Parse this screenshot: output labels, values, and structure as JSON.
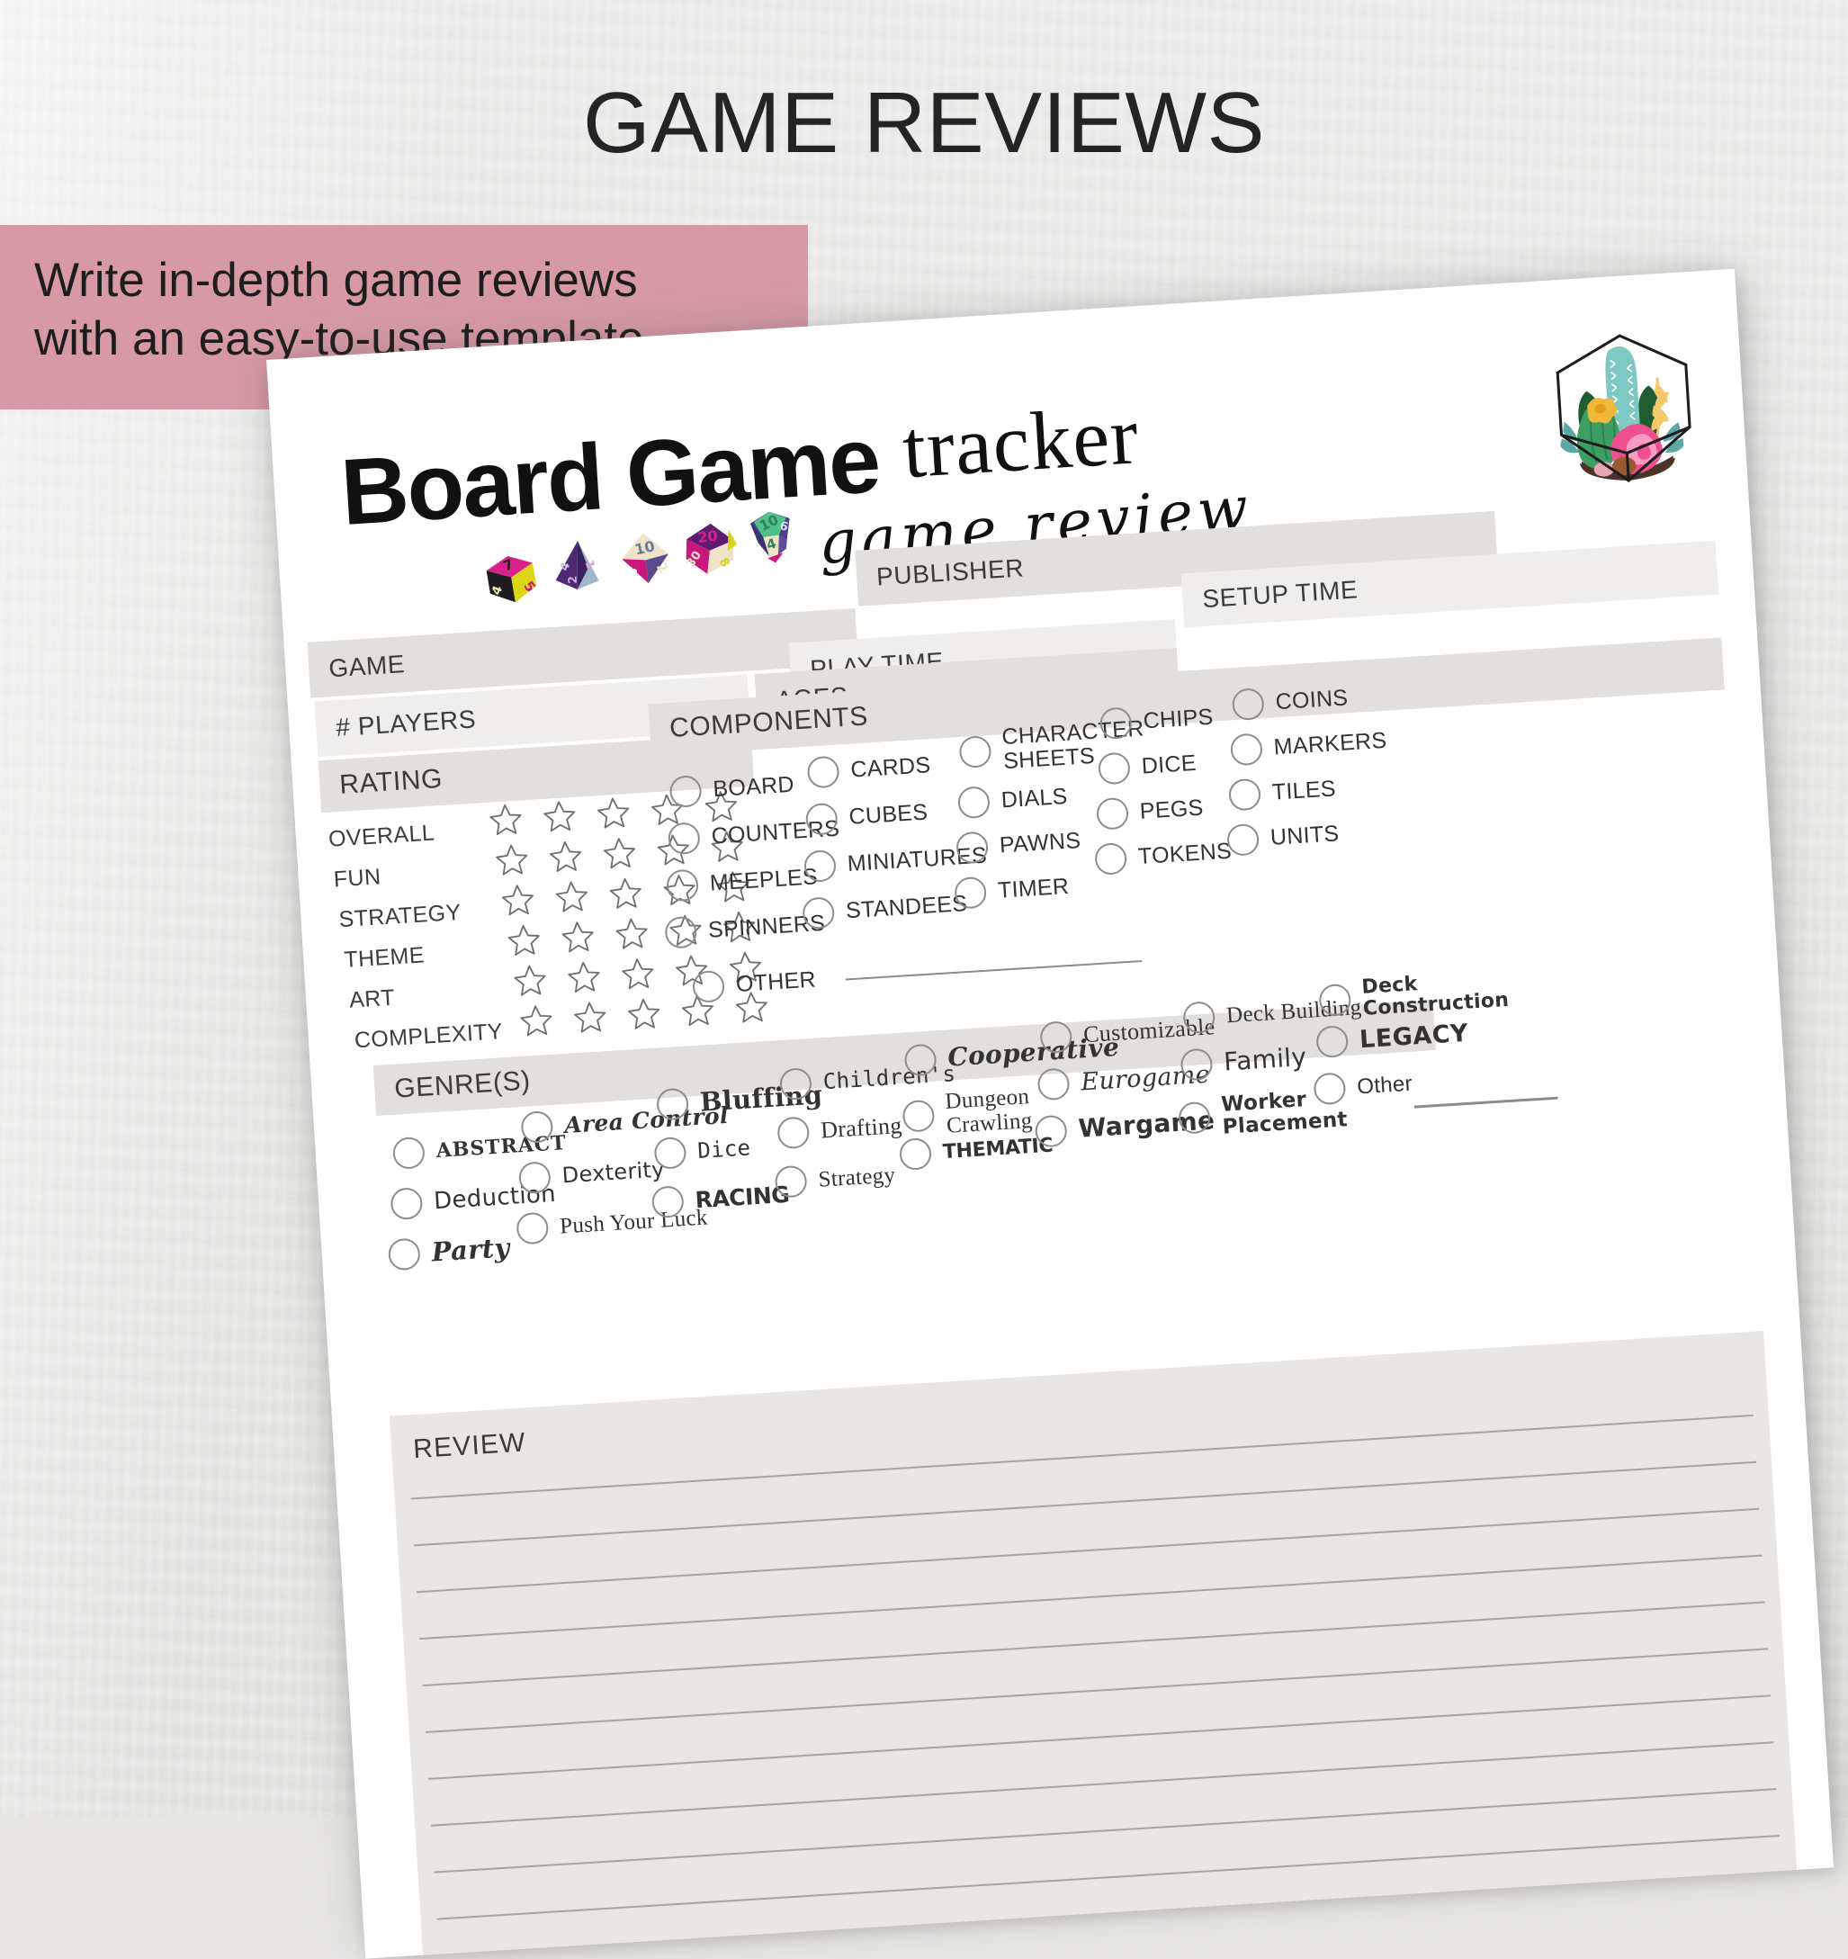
{
  "promo": {
    "title": "GAME REVIEWS",
    "band_line_1": "Write in-depth game reviews",
    "band_line_2": "with an easy-to-use template",
    "band_color": "#d79aa5",
    "background_color": "#e7e6e4"
  },
  "sheet": {
    "logo_bold": "Board Game",
    "logo_script": "tracker",
    "logo_sub": "game review",
    "accent_field_color": "#e2dfdc",
    "paper_color": "#ffffff"
  },
  "fields": [
    {
      "label": "GAME"
    },
    {
      "label": "PUBLISHER"
    },
    {
      "label": "PLAY TIME"
    },
    {
      "label": "SETUP TIME"
    },
    {
      "label": "# PLAYERS"
    },
    {
      "label": "AGES"
    }
  ],
  "rating": {
    "heading": "RATING",
    "max_stars": 5,
    "rows": [
      {
        "label": "OVERALL",
        "stars": 0
      },
      {
        "label": "FUN",
        "stars": 0
      },
      {
        "label": "STRATEGY",
        "stars": 0
      },
      {
        "label": "THEME",
        "stars": 0
      },
      {
        "label": "ART",
        "stars": 0
      },
      {
        "label": "COMPLEXITY",
        "stars": 0
      }
    ]
  },
  "components": {
    "heading": "COMPONENTS",
    "col1": [
      "BOARD",
      "COUNTERS",
      "MEEPLES",
      "SPINNERS"
    ],
    "col2": [
      "CARDS",
      "CUBES",
      "MINIATURES",
      "STANDEES"
    ],
    "col3": [
      "CHARACTER SHEETS",
      "DIALS",
      "PAWNS",
      "TIMER"
    ],
    "col4": [
      "CHIPS",
      "DICE",
      "PEGS",
      "TOKENS"
    ],
    "col5": [
      "COINS",
      "MARKERS",
      "TILES",
      "UNITS"
    ],
    "other_label": "OTHER"
  },
  "genres": {
    "heading": "GENRE(S)",
    "col1": [
      "ABSTRACT",
      "Deduction",
      "Party"
    ],
    "col2": [
      "Area Control",
      "Dexterity",
      "Push Your Luck"
    ],
    "col3": [
      "Bluffing",
      "Dice",
      "RACING"
    ],
    "col4": [
      "Children's",
      "Drafting",
      "Strategy"
    ],
    "col5": [
      "Cooperative",
      "Dungeon Crawling",
      "THEMATIC"
    ],
    "col6": [
      "Customizable",
      "Eurogame",
      "Wargame"
    ],
    "col7": [
      "Deck Building",
      "Family",
      "Worker Placement"
    ],
    "col8": [
      "Deck Construction",
      "LEGACY",
      "Other"
    ]
  },
  "review": {
    "heading": "REVIEW",
    "line_count": 10
  },
  "icons": {
    "star": "star-outline-icon",
    "checkbox": "radio-circle-icon",
    "terrarium": "cactus-terrarium-icon",
    "dice": "polyhedral-dice-icon"
  },
  "dice": [
    {
      "name": "d6",
      "faces": [
        "7",
        "4",
        "5"
      ],
      "colors": [
        "#d9218e",
        "#1d1d1d",
        "#ddd617"
      ]
    },
    {
      "name": "d4",
      "faces": [
        "4",
        "1",
        "2"
      ],
      "colors": [
        "#4b2a72",
        "#3b2160",
        "#9fb6cd"
      ]
    },
    {
      "name": "d8",
      "faces": [
        "10",
        "3",
        "2"
      ],
      "colors": [
        "#efe3c8",
        "#c9177e",
        "#5a4a8c"
      ]
    },
    {
      "name": "d20",
      "faces": [
        "20",
        "30",
        "8"
      ],
      "colors": [
        "#5c1d6e",
        "#efe3c8",
        "#d9d21a"
      ]
    },
    {
      "name": "d12",
      "faces": [
        "10",
        "4",
        "6"
      ],
      "colors": [
        "#4fc18a",
        "#efe3c8",
        "#4b3e86"
      ]
    }
  ],
  "terrarium_colors": {
    "glass_outline": "#1d1d1d",
    "tall_cactus": "#7ec9c4",
    "dark_cactus": "#1f5c32",
    "round_cactus": "#3d9e62",
    "pink_flower": "#ef4f8f",
    "pink_flower_light": "#f79cc0",
    "yellow_flower": "#f0b93a",
    "yellow_leaf": "#f6c96a",
    "soil": "#4a3327",
    "pebble_brown": "#9a5b34",
    "pebble_pink": "#e8a7b4",
    "teal_leaf": "#5ba8a4"
  }
}
